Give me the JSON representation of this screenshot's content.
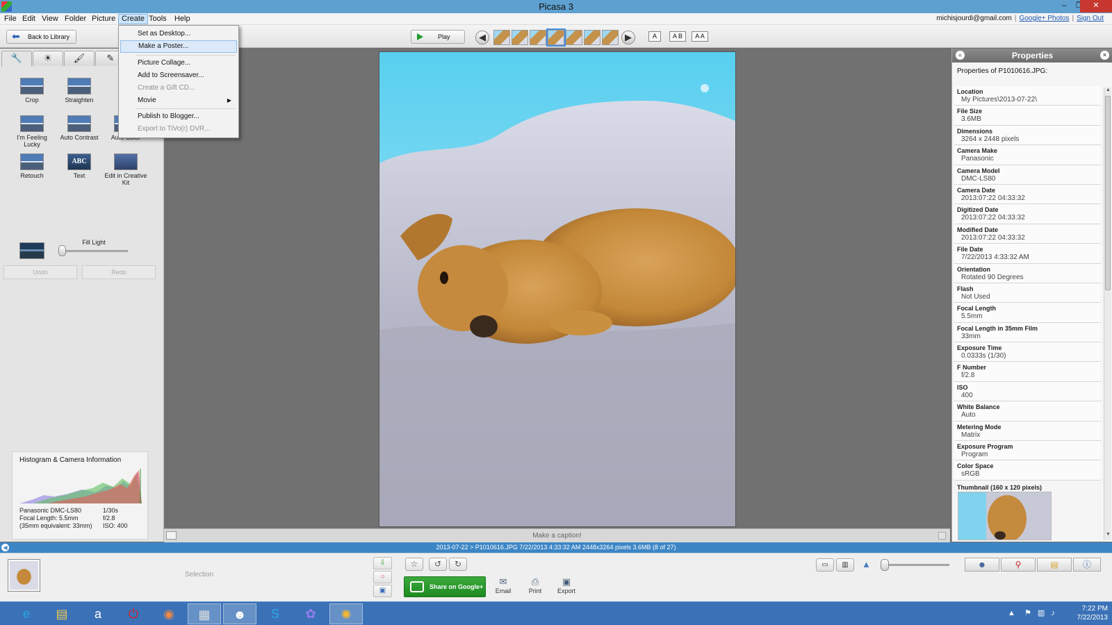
{
  "window": {
    "title": "Picasa 3",
    "controls": {
      "minimize": "–",
      "restore": "❐",
      "close": "✕"
    }
  },
  "menubar": {
    "items": [
      "File",
      "Edit",
      "View",
      "Folder",
      "Picture",
      "Create",
      "Tools",
      "Help"
    ],
    "active_item": "Create",
    "account": {
      "email": "michisjourdi@gmail.com",
      "separator": "|",
      "google_photos": "Google+ Photos",
      "sign_out": "Sign Out"
    }
  },
  "create_menu": {
    "items": [
      {
        "label": "Set as Desktop...",
        "enabled": true
      },
      {
        "label": "Make a Poster...",
        "enabled": true,
        "highlighted": true
      },
      {
        "label": "Picture Collage...",
        "enabled": true
      },
      {
        "label": "Add to Screensaver...",
        "enabled": true
      },
      {
        "label": "Create a Gift CD...",
        "enabled": false
      },
      {
        "label": "Movie",
        "enabled": true,
        "submenu_glyph": "▶"
      },
      {
        "label": "Publish to Blogger...",
        "enabled": true
      },
      {
        "label": "Export to TiVo(r) DVR...",
        "enabled": false
      }
    ]
  },
  "toolbar": {
    "back_label": "Back to Library",
    "play_label": "Play",
    "caption_modes": [
      "A",
      "A B",
      "A A"
    ],
    "nav_prev_icon": "left-arrow-icon",
    "nav_next_icon": "right-arrow-icon"
  },
  "edit_panel": {
    "tabs": [
      "wrench-icon",
      "sun-icon",
      "brush-icon",
      "effects-icon"
    ],
    "tab_glyphs": [
      "🔧",
      "☀",
      "🖌",
      "✎"
    ],
    "tools": [
      {
        "label": "Crop"
      },
      {
        "label": "Straighten"
      },
      {
        "label": "I'm Feeling Lucky"
      },
      {
        "label": "Auto Contrast"
      },
      {
        "label": "Auto Color"
      },
      {
        "label": "Retouch"
      },
      {
        "label": "Text"
      },
      {
        "label": "Edit in Creative Kit"
      }
    ],
    "fill_light": {
      "label": "Fill Light",
      "value": 0
    },
    "undo_label": "Undo",
    "redo_label": "Redo"
  },
  "histogram": {
    "title": "Histogram & Camera Information",
    "camera": {
      "model": "Panasonic DMC-LS80",
      "focal_length": "Focal Length: 5.5mm",
      "equivalent": "(35mm equivalent:  33mm)",
      "exposure": "1/30s",
      "fstop": "f/2.8",
      "iso": "ISO: 400"
    }
  },
  "caption": {
    "placeholder": "Make a caption!"
  },
  "properties": {
    "title": "Properties",
    "subtitle": "Properties of P1010616.JPG:",
    "rows": [
      {
        "key": "Location",
        "value": "My Pictures\\2013-07-22\\"
      },
      {
        "key": "File Size",
        "value": "3.6MB"
      },
      {
        "key": "Dimensions",
        "value": "3264 x 2448 pixels"
      },
      {
        "key": "Camera Make",
        "value": "Panasonic"
      },
      {
        "key": "Camera Model",
        "value": "DMC-LS80"
      },
      {
        "key": "Camera Date",
        "value": "2013:07:22 04:33:32"
      },
      {
        "key": "Digitized Date",
        "value": "2013:07:22 04:33:32"
      },
      {
        "key": "Modified Date",
        "value": "2013:07:22 04:33:32"
      },
      {
        "key": "File Date",
        "value": "7/22/2013 4:33:32 AM"
      },
      {
        "key": "Orientation",
        "value": "Rotated 90 Degrees"
      },
      {
        "key": "Flash",
        "value": "Not Used"
      },
      {
        "key": "Focal Length",
        "value": "5.5mm"
      },
      {
        "key": "Focal Length in 35mm Film",
        "value": "33mm"
      },
      {
        "key": "Exposure Time",
        "value": "0.0333s (1/30)"
      },
      {
        "key": "F Number",
        "value": "f/2.8"
      },
      {
        "key": "ISO",
        "value": "400"
      },
      {
        "key": "White Balance",
        "value": "Auto"
      },
      {
        "key": "Metering Mode",
        "value": "Matrix"
      },
      {
        "key": "Exposure Program",
        "value": "Program"
      },
      {
        "key": "Color Space",
        "value": "sRGB"
      }
    ],
    "thumbnail_label": "Thumbnail (160 x 120 pixels)"
  },
  "status": {
    "text": "2013-07-22 > P1010616.JPG     7/22/2013 4:33:32 AM     2448x3264 pixels     3.6MB     (8 of 27)"
  },
  "tray": {
    "selection_label": "Selection",
    "share_label": "Share on Google+",
    "actions": [
      {
        "label": "Email",
        "icon": "envelope-icon",
        "glyph": "✉"
      },
      {
        "label": "Print",
        "icon": "printer-icon",
        "glyph": "⎙"
      },
      {
        "label": "Export",
        "icon": "export-folder-icon",
        "glyph": "▣"
      }
    ],
    "zoom_level": 0
  },
  "taskbar": {
    "apps": [
      {
        "name": "internet-explorer-icon",
        "glyph": "e",
        "color": "#27a6e5"
      },
      {
        "name": "file-explorer-icon",
        "glyph": "▤",
        "color": "#f2c94c"
      },
      {
        "name": "amazon-icon",
        "glyph": "a",
        "color": "#ffffff"
      },
      {
        "name": "power-app-icon",
        "glyph": "⏻",
        "color": "#c22"
      },
      {
        "name": "chrome-icon",
        "glyph": "◉",
        "color": "#e84"
      },
      {
        "name": "documents-icon",
        "glyph": "▦",
        "color": "#ddd"
      },
      {
        "name": "panda-icon",
        "glyph": "☻",
        "color": "#ffffff"
      },
      {
        "name": "skype-icon",
        "glyph": "S",
        "color": "#2aa9e8"
      },
      {
        "name": "flower-app-icon",
        "glyph": "✿",
        "color": "#9a7cf0"
      },
      {
        "name": "picasa-icon",
        "glyph": "✺",
        "color": "#f5b82e"
      }
    ],
    "time": "7:22 PM",
    "date": "7/22/2013"
  }
}
